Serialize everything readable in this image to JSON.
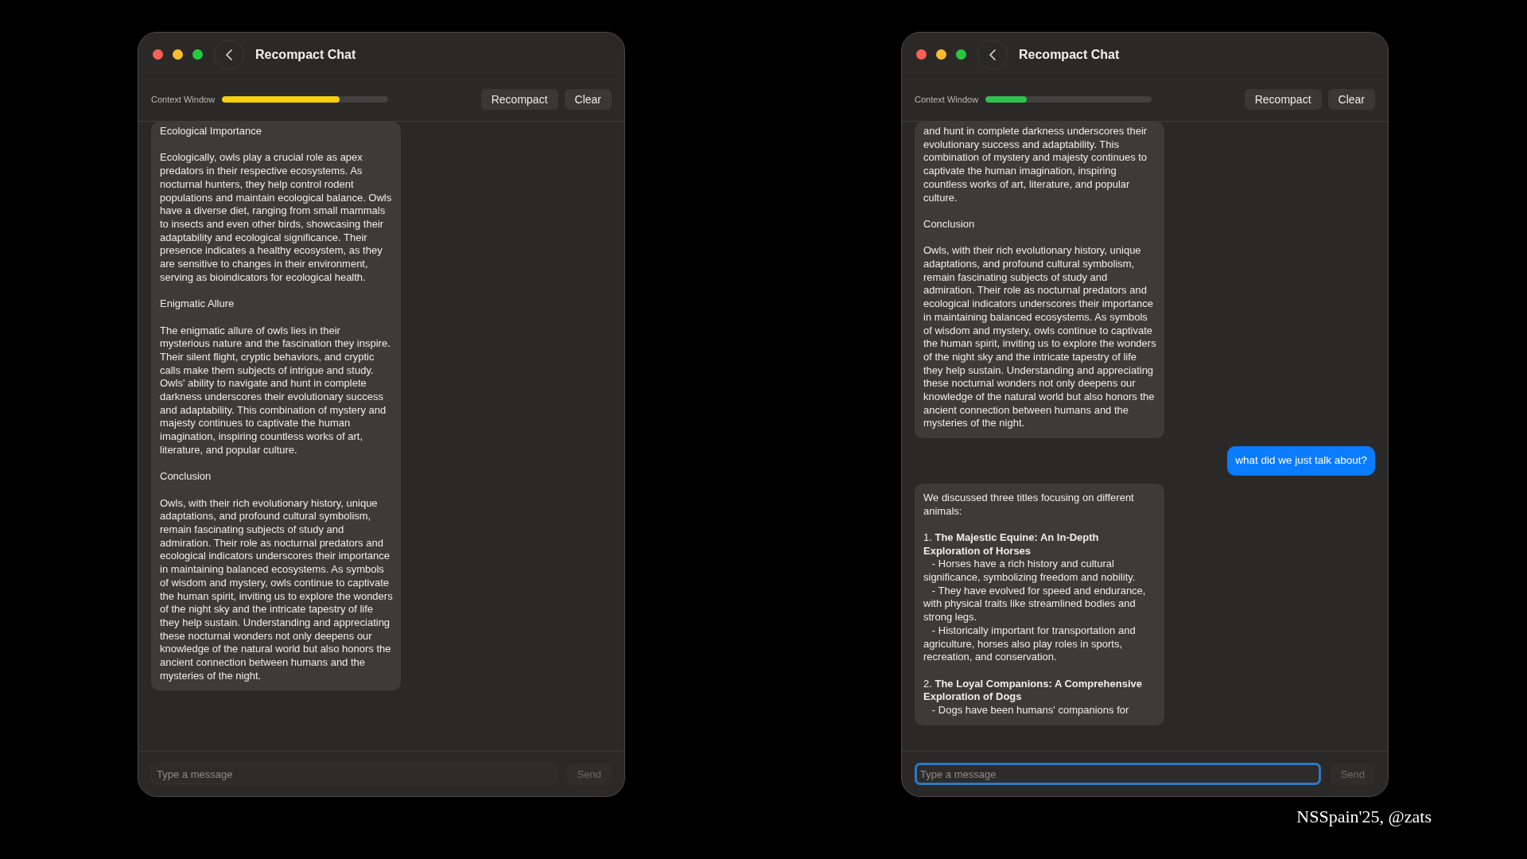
{
  "windows": [
    {
      "title": "Recompact Chat",
      "context": {
        "label": "Context Window",
        "level": 0.71,
        "color": "#f5cf12"
      },
      "buttons": [
        "Recompact",
        "Clear"
      ],
      "messages": [
        {
          "kind": "assistant",
          "blocks": [
            "Ecological Importance",
            "Ecologically, owls play a crucial role as apex predators in their respective ecosystems. As nocturnal hunters, they help control rodent populations and maintain ecological balance. Owls have a diverse diet, ranging from small mammals to insects and even other birds, showcasing their adaptability and ecological significance. Their presence indicates a healthy ecosystem, as they are sensitive to changes in their environment, serving as bioindicators for ecological health.",
            "Enigmatic Allure",
            "The enigmatic allure of owls lies in their mysterious nature and the fascination they inspire. Their silent flight, cryptic behaviors, and cryptic calls make them subjects of intrigue and study. Owls' ability to navigate and hunt in complete darkness underscores their evolutionary success and adaptability. This combination of mystery and majesty continues to captivate the human imagination, inspiring countless works of art, literature, and popular culture.",
            "Conclusion",
            "Owls, with their rich evolutionary history, unique adaptations, and profound cultural symbolism, remain fascinating subjects of study and admiration. Their role as nocturnal predators and ecological indicators underscores their importance in maintaining balanced ecosystems. As symbols of wisdom and mystery, owls continue to captivate the human spirit, inviting us to explore the wonders of the night sky and the intricate tapestry of life they help sustain. Understanding and appreciating these nocturnal wonders not only deepens our knowledge of the natural world but also honors the ancient connection between humans and the mysteries of the night."
          ]
        }
      ],
      "input": {
        "placeholder": "Type a message",
        "focused": false
      },
      "send": {
        "label": "Send",
        "disabled": true
      }
    },
    {
      "title": "Recompact Chat",
      "context": {
        "label": "Context Window",
        "level": 0.25,
        "color": "#30c24f"
      },
      "buttons": [
        "Recompact",
        "Clear"
      ],
      "messages": [
        {
          "kind": "assistant",
          "blocks": [
            "and hunt in complete darkness underscores their evolutionary success and adaptability. This combination of mystery and majesty continues to captivate the human imagination, inspiring countless works of art, literature, and popular culture.",
            "Conclusion",
            "Owls, with their rich evolutionary history, unique adaptations, and profound cultural symbolism, remain fascinating subjects of study and admiration. Their role as nocturnal predators and ecological indicators underscores their importance in maintaining balanced ecosystems. As symbols of wisdom and mystery, owls continue to captivate the human spirit, inviting us to explore the wonders of the night sky and the intricate tapestry of life they help sustain. Understanding and appreciating these nocturnal wonders not only deepens our knowledge of the natural world but also honors the ancient connection between humans and the mysteries of the night."
          ]
        },
        {
          "kind": "user",
          "blocks": [
            "what did we just talk about?"
          ]
        },
        {
          "kind": "assistant",
          "blocks": [
            "We discussed three titles focusing on different animals:",
            "1. **The Majestic Equine: An In-Depth Exploration of Horses**\n   - Horses have a rich history and cultural significance, symbolizing freedom and nobility.\n   - They have evolved for speed and endurance, with physical traits like streamlined bodies and strong legs.\n   - Historically important for transportation and agriculture, horses also play roles in sports, recreation, and conservation.",
            "2. **The Loyal Companions: A Comprehensive Exploration of Dogs**\n   - Dogs have been humans' companions for"
          ]
        }
      ],
      "input": {
        "placeholder": "Type a message",
        "focused": true
      },
      "send": {
        "label": "Send",
        "disabled": true
      }
    }
  ],
  "footer": "NSSpain'25, @zats"
}
